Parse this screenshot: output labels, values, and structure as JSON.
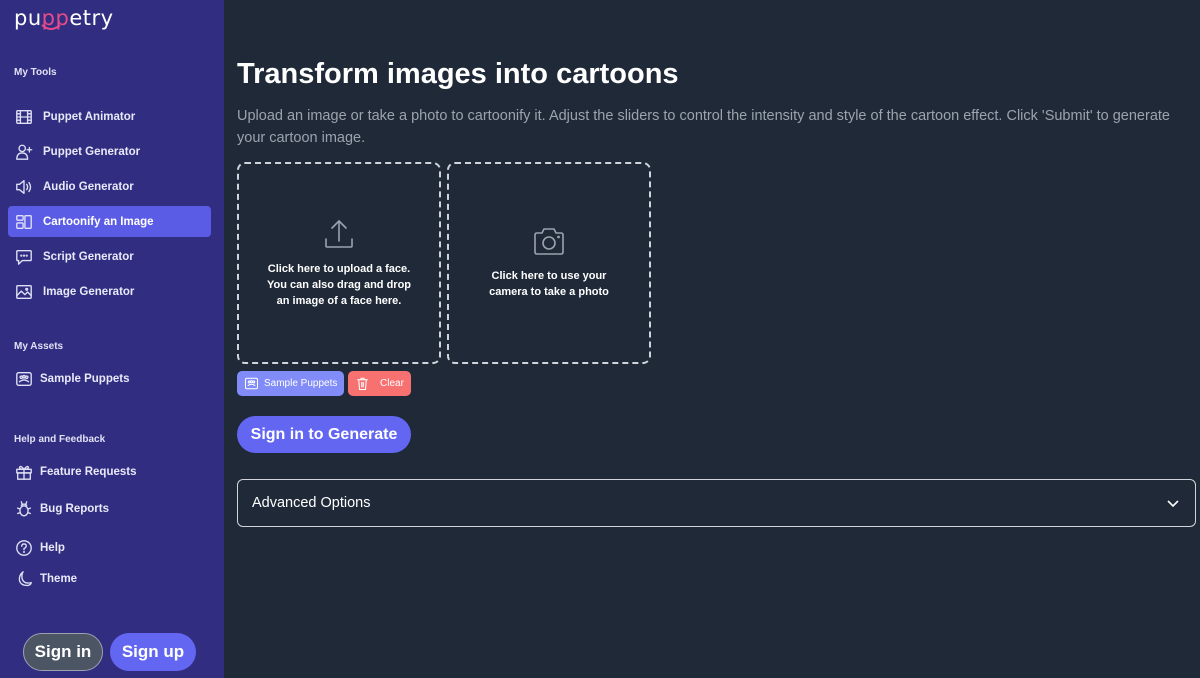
{
  "app": {
    "logo_prefix": "pu",
    "logo_highlight": "pp",
    "logo_suffix": "etry"
  },
  "sidebar": {
    "sections": [
      {
        "label": "My Tools",
        "items": [
          {
            "label": "Puppet Animator",
            "icon": "film-icon",
            "active": false
          },
          {
            "label": "Puppet Generator",
            "icon": "user-plus-icon",
            "active": false
          },
          {
            "label": "Audio Generator",
            "icon": "speaker-icon",
            "active": false
          },
          {
            "label": "Cartoonify an Image",
            "icon": "layout-icon",
            "active": true
          },
          {
            "label": "Script Generator",
            "icon": "chat-bubble-icon",
            "active": false
          },
          {
            "label": "Image Generator",
            "icon": "image-icon",
            "active": false
          }
        ]
      },
      {
        "label": "My Assets",
        "items": [
          {
            "label": "Sample Puppets",
            "icon": "group-icon",
            "active": false
          }
        ]
      },
      {
        "label": "Help and Feedback",
        "items": [
          {
            "label": "Feature Requests",
            "icon": "gift-icon",
            "active": false
          },
          {
            "label": "Bug Reports",
            "icon": "bug-icon",
            "active": false
          },
          {
            "label": "Help",
            "icon": "question-circle-icon",
            "active": false
          },
          {
            "label": "Theme",
            "icon": "moon-icon",
            "active": false
          }
        ]
      }
    ],
    "sign_in_label": "Sign in",
    "sign_up_label": "Sign up"
  },
  "main": {
    "title": "Transform images into cartoons",
    "description": "Upload an image or take a photo to cartoonify it. Adjust the sliders to control the intensity and style of the cartoon effect. Click 'Submit' to generate your cartoon image.",
    "upload_box": {
      "line1": "Click here to upload a face.",
      "line2": "You can also drag and drop",
      "line3": "an image of a face here."
    },
    "camera_box": {
      "line1": "Click here to use your",
      "line2": "camera to take a photo"
    },
    "sample_puppets_label": "Sample Puppets",
    "clear_label": "Clear",
    "generate_label": "Sign in to Generate",
    "advanced_options_label": "Advanced Options"
  },
  "colors": {
    "sidebar_bg": "#312e81",
    "main_bg": "#1f2937",
    "accent": "#6366f1",
    "clear": "#f87171",
    "logo_highlight": "#e64a8a"
  }
}
